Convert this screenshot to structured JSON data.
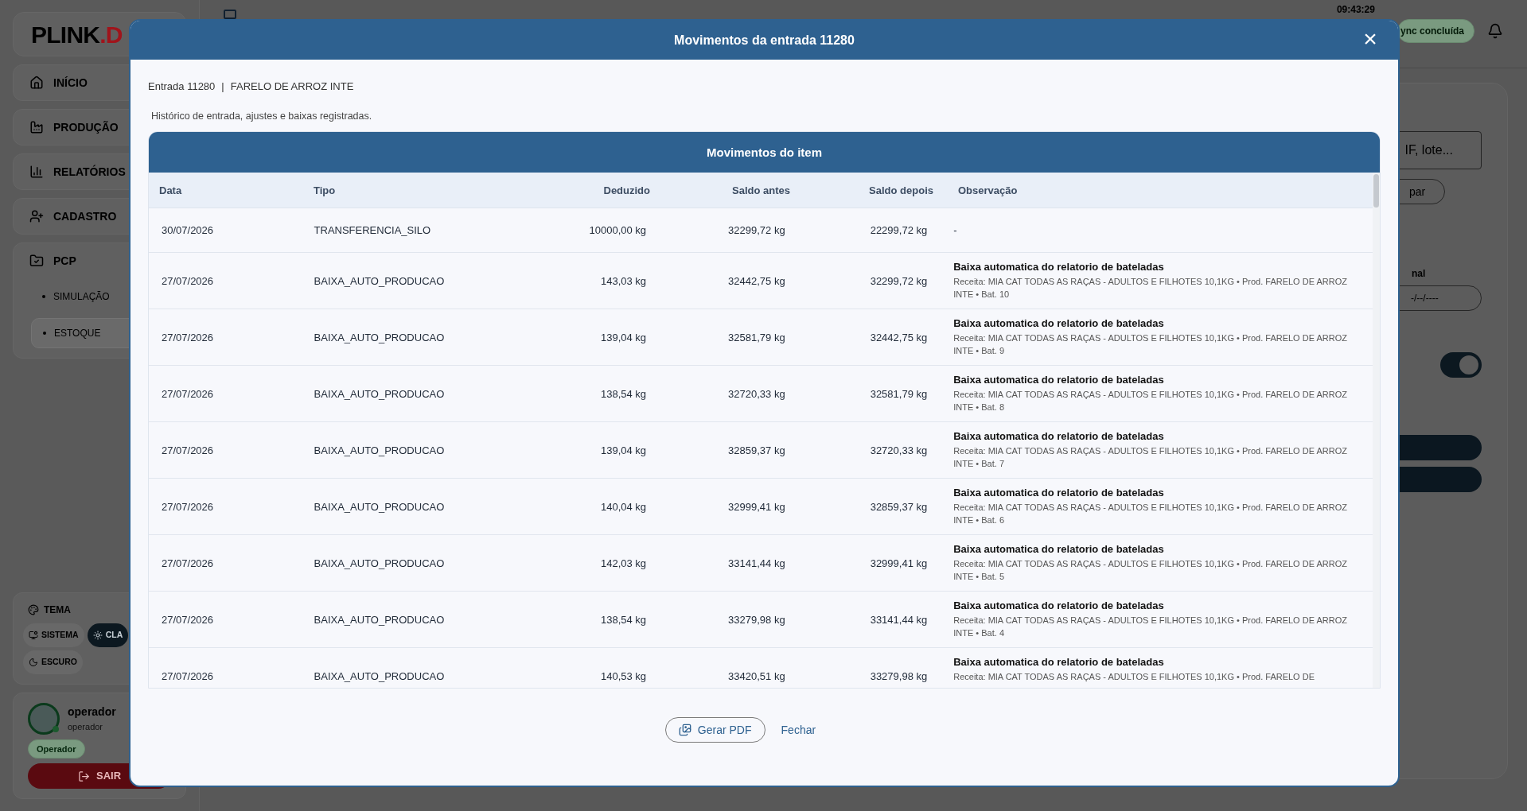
{
  "sidebar": {
    "logo": {
      "text": "PLINK",
      "accent": ".D"
    },
    "nav": [
      {
        "label": "INÍCIO"
      },
      {
        "label": "PRODUÇÃO"
      },
      {
        "label": "RELATÓRIOS"
      },
      {
        "label": "CADASTRO"
      },
      {
        "label": "PCP",
        "expanded": true,
        "children": [
          {
            "label": "SIMULAÇÃO",
            "selected": false
          },
          {
            "label": "ESTOQUE",
            "selected": true
          }
        ]
      }
    ],
    "theme": {
      "label": "TEMA",
      "options": [
        {
          "label": "SISTEMA",
          "selected": false
        },
        {
          "label": "CLA",
          "selected": true
        },
        {
          "label": "ESCURO",
          "selected": false
        }
      ]
    },
    "user": {
      "name": "operador",
      "subtitle": "operador",
      "role": "Operador",
      "logout": "SAIR"
    }
  },
  "topbar": {
    "time": "09:43:29",
    "sync": "ync concluída"
  },
  "background_panel": {
    "search_placeholder": "IF, lote...",
    "button": "par",
    "date_label": "nal",
    "date_placeholder": "-/--/----",
    "toggle_on": true
  },
  "modal": {
    "title": "Movimentos da entrada 11280",
    "close": "×",
    "entry": "Entrada 11280",
    "separator": "|",
    "product": "FARELO DE ARROZ INTE",
    "description": "Histórico de entrada, ajustes e baixas registradas.",
    "table": {
      "title": "Movimentos do item",
      "columns": [
        "Data",
        "Tipo",
        "Deduzido",
        "Saldo antes",
        "Saldo depois",
        "Observação"
      ],
      "rows": [
        {
          "date": "30/07/2026",
          "type": "TRANSFERENCIA_SILO",
          "deducted": "10000,00 kg",
          "before": "32299,72 kg",
          "after": "22299,72 kg",
          "note": "-"
        },
        {
          "date": "27/07/2026",
          "type": "BAIXA_AUTO_PRODUCAO",
          "deducted": "143,03 kg",
          "before": "32442,75 kg",
          "after": "32299,72 kg",
          "note_title": "Baixa automatica do relatorio de bateladas",
          "note_detail": "Receita: MIA CAT TODAS AS RAÇAS - ADULTOS E FILHOTES 10,1KG • Prod. FARELO DE ARROZ INTE • Bat. 10"
        },
        {
          "date": "27/07/2026",
          "type": "BAIXA_AUTO_PRODUCAO",
          "deducted": "139,04 kg",
          "before": "32581,79 kg",
          "after": "32442,75 kg",
          "note_title": "Baixa automatica do relatorio de bateladas",
          "note_detail": "Receita: MIA CAT TODAS AS RAÇAS - ADULTOS E FILHOTES 10,1KG • Prod. FARELO DE ARROZ INTE • Bat. 9"
        },
        {
          "date": "27/07/2026",
          "type": "BAIXA_AUTO_PRODUCAO",
          "deducted": "138,54 kg",
          "before": "32720,33 kg",
          "after": "32581,79 kg",
          "note_title": "Baixa automatica do relatorio de bateladas",
          "note_detail": "Receita: MIA CAT TODAS AS RAÇAS - ADULTOS E FILHOTES 10,1KG • Prod. FARELO DE ARROZ INTE • Bat. 8"
        },
        {
          "date": "27/07/2026",
          "type": "BAIXA_AUTO_PRODUCAO",
          "deducted": "139,04 kg",
          "before": "32859,37 kg",
          "after": "32720,33 kg",
          "note_title": "Baixa automatica do relatorio de bateladas",
          "note_detail": "Receita: MIA CAT TODAS AS RAÇAS - ADULTOS E FILHOTES 10,1KG • Prod. FARELO DE ARROZ INTE • Bat. 7"
        },
        {
          "date": "27/07/2026",
          "type": "BAIXA_AUTO_PRODUCAO",
          "deducted": "140,04 kg",
          "before": "32999,41 kg",
          "after": "32859,37 kg",
          "note_title": "Baixa automatica do relatorio de bateladas",
          "note_detail": "Receita: MIA CAT TODAS AS RAÇAS - ADULTOS E FILHOTES 10,1KG • Prod. FARELO DE ARROZ INTE • Bat. 6"
        },
        {
          "date": "27/07/2026",
          "type": "BAIXA_AUTO_PRODUCAO",
          "deducted": "142,03 kg",
          "before": "33141,44 kg",
          "after": "32999,41 kg",
          "note_title": "Baixa automatica do relatorio de bateladas",
          "note_detail": "Receita: MIA CAT TODAS AS RAÇAS - ADULTOS E FILHOTES 10,1KG • Prod. FARELO DE ARROZ INTE • Bat. 5"
        },
        {
          "date": "27/07/2026",
          "type": "BAIXA_AUTO_PRODUCAO",
          "deducted": "138,54 kg",
          "before": "33279,98 kg",
          "after": "33141,44 kg",
          "note_title": "Baixa automatica do relatorio de bateladas",
          "note_detail": "Receita: MIA CAT TODAS AS RAÇAS - ADULTOS E FILHOTES 10,1KG • Prod. FARELO DE ARROZ INTE • Bat. 4"
        },
        {
          "date": "27/07/2026",
          "type": "BAIXA_AUTO_PRODUCAO",
          "deducted": "140,53 kg",
          "before": "33420,51 kg",
          "after": "33279,98 kg",
          "note_title": "Baixa automatica do relatorio de bateladas",
          "note_detail": "Receita: MIA CAT TODAS AS RAÇAS - ADULTOS E FILHOTES 10,1KG • Prod. FARELO DE"
        }
      ]
    },
    "buttons": {
      "pdf": "Gerar PDF",
      "close": "Fechar"
    }
  }
}
